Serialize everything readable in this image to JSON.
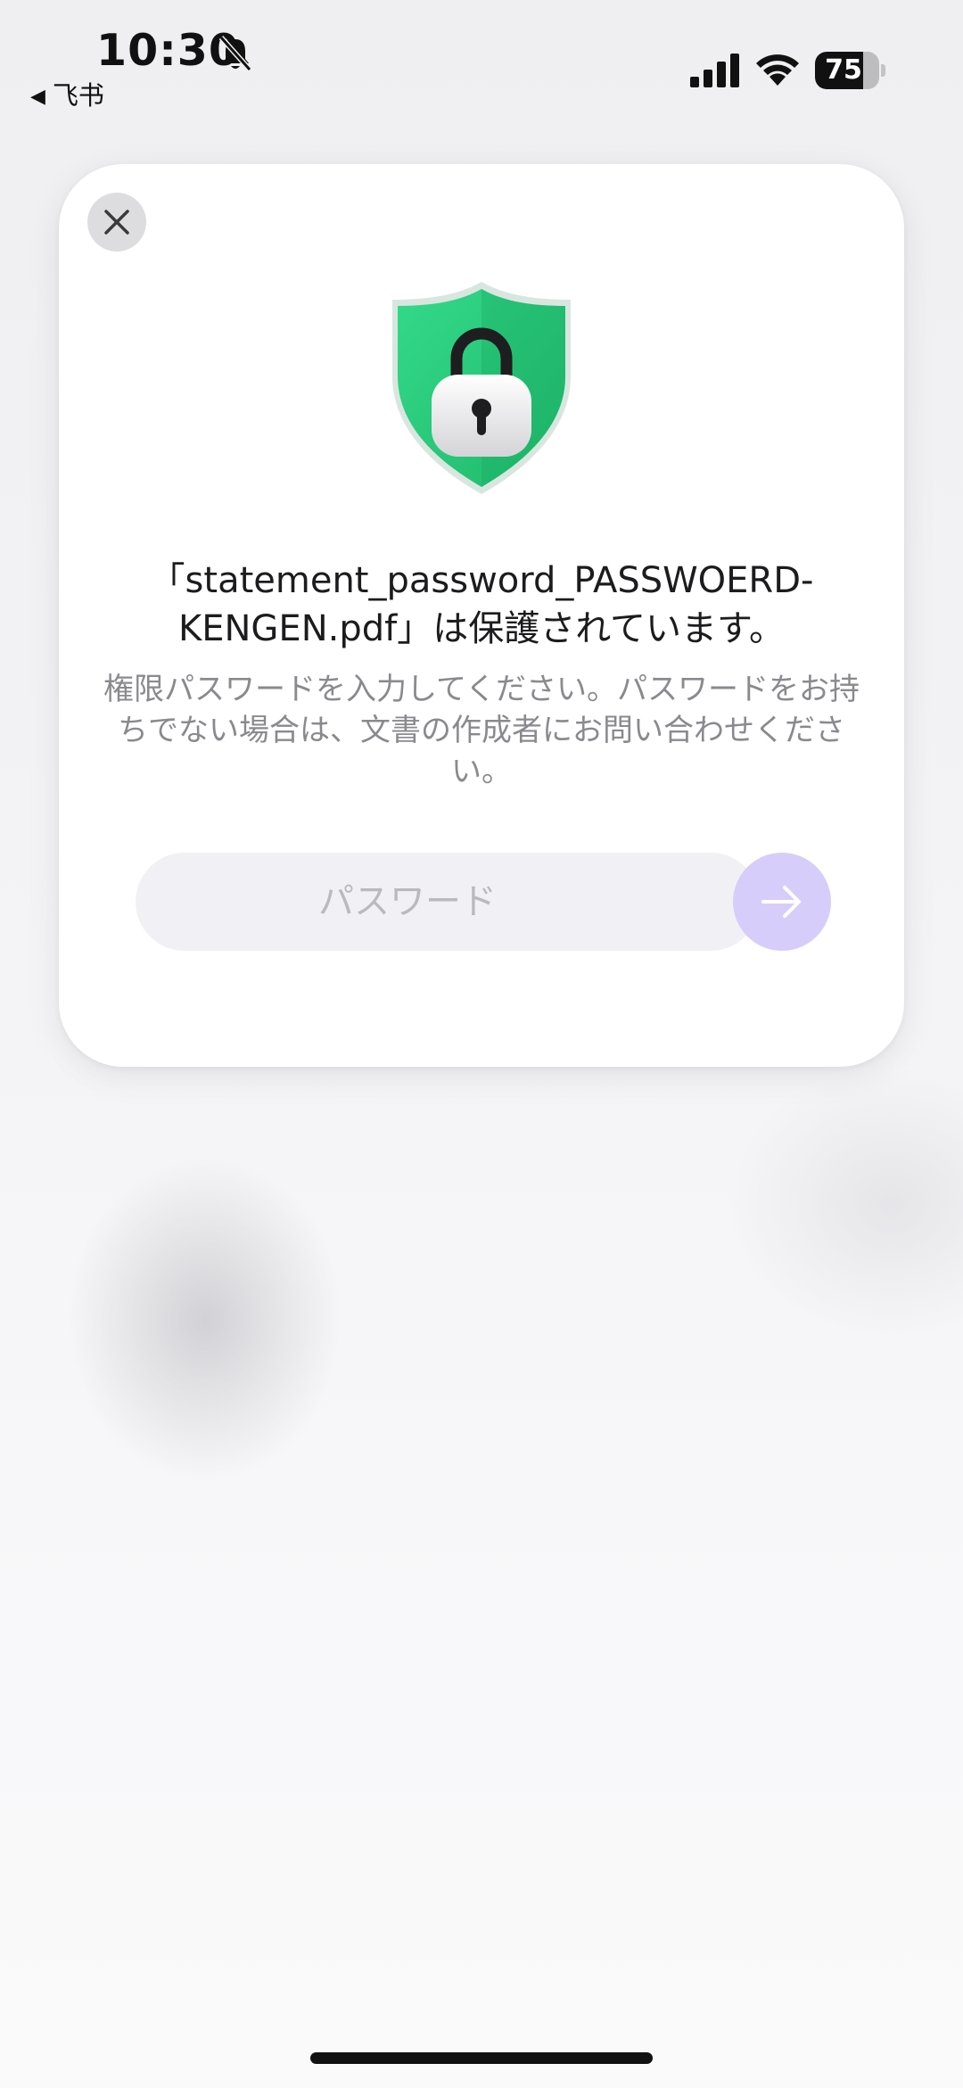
{
  "status_bar": {
    "time": "10:30",
    "back_app": "飞书",
    "battery_level": 75,
    "battery_text": "75"
  },
  "dialog": {
    "title": "「statement_password_PASSWOERD-KENGEN.pdf」は保護されています。",
    "message": "権限パスワードを入力してください。パスワードをお持ちでない場合は、文書の作成者にお問い合わせください。",
    "password_placeholder": "パスワード",
    "password_value": ""
  },
  "icons": {
    "close": "close-icon",
    "shield": "shield-lock-icon",
    "submit": "arrow-right-icon",
    "mute": "bell-slash-icon",
    "signal": "cellular-signal-icon",
    "wifi": "wifi-icon"
  },
  "colors": {
    "accent": "#d7cdfa",
    "shield_green": "#2ecf7f",
    "close_bg": "#dddde0"
  }
}
